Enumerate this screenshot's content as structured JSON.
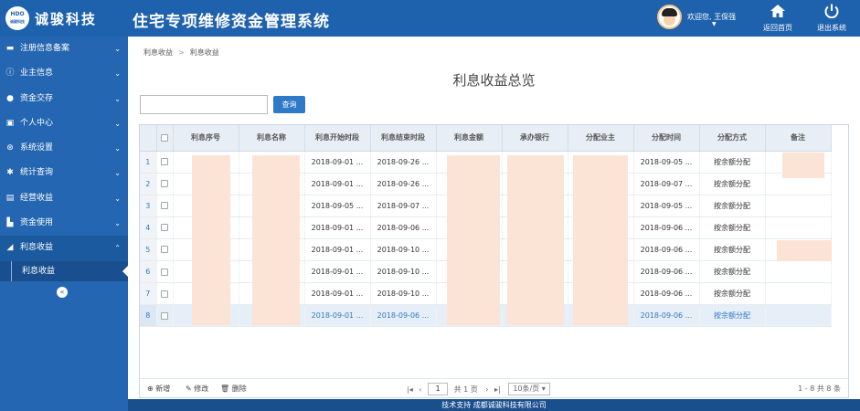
{
  "header": {
    "logo_text": "HDO",
    "logo_sub": "诚骏科技",
    "company": "诚骏科技",
    "system_title": "住宅专项维修资金管理系统",
    "welcome": "欢迎您, 王保强",
    "home_label": "返回首页",
    "exit_label": "退出系统"
  },
  "sidebar": {
    "items": [
      {
        "label": "注册信息备案",
        "icon": "id-card-icon"
      },
      {
        "label": "业主信息",
        "icon": "info-icon"
      },
      {
        "label": "资金交存",
        "icon": "user-icon"
      },
      {
        "label": "个人中心",
        "icon": "person-card-icon"
      },
      {
        "label": "系统设置",
        "icon": "settings-icon"
      },
      {
        "label": "统计查询",
        "icon": "gear-icon"
      },
      {
        "label": "经营收益",
        "icon": "database-icon"
      },
      {
        "label": "资金使用",
        "icon": "bar-chart-icon"
      },
      {
        "label": "利息收益",
        "icon": "area-chart-icon"
      }
    ],
    "sub_items": [
      {
        "label": "利息收益"
      }
    ]
  },
  "breadcrumb": {
    "first": "利息收益",
    "second": "利息收益"
  },
  "page_title": "利息收益总览",
  "search": {
    "value": "",
    "button_label": "查询"
  },
  "table": {
    "columns": [
      "利息序号",
      "利息名称",
      "利息开始时段",
      "利息结束时段",
      "利息金额",
      "承办银行",
      "分配业主",
      "分配时间",
      "分配方式",
      "备注"
    ],
    "rows": [
      {
        "n": "1",
        "start": "2018-09-01 ...",
        "end": "2018-09-26 ...",
        "time": "2018-09-05 ...",
        "method": "按余额分配"
      },
      {
        "n": "2",
        "start": "2018-09-01 ...",
        "end": "2018-09-26 ...",
        "time": "2018-09-07 ...",
        "method": "按余额分配"
      },
      {
        "n": "3",
        "start": "2018-09-05 ...",
        "end": "2018-09-07 ...",
        "time": "2018-09-05 ...",
        "method": "按余额分配"
      },
      {
        "n": "4",
        "start": "2018-09-01 ...",
        "end": "2018-09-06 ...",
        "time": "2018-09-06 ...",
        "method": "按余额分配"
      },
      {
        "n": "5",
        "start": "2018-09-01 ...",
        "end": "2018-09-10 ...",
        "time": "2018-09-06 ...",
        "method": "按余额分配"
      },
      {
        "n": "6",
        "start": "2018-09-01 ...",
        "end": "2018-09-10 ...",
        "time": "2018-09-06 ...",
        "method": "按余额分配"
      },
      {
        "n": "7",
        "start": "2018-09-01 ...",
        "end": "2018-09-10 ...",
        "time": "2018-09-06 ...",
        "method": "按余额分配"
      },
      {
        "n": "8",
        "start": "2018-09-01 ...",
        "end": "2018-09-06 ...",
        "time": "2018-09-06 ...",
        "method": "按余额分配"
      }
    ]
  },
  "toolbar": {
    "add": "新增",
    "edit": "修改",
    "delete": "删除"
  },
  "pager": {
    "page": "1",
    "of_pages": "共 1 页",
    "page_size": "10条/页",
    "range": "1 - 8   共 8 条"
  },
  "footer": "技术支持 成都诚骏科技有限公司",
  "colors": {
    "header": "#1e61ad",
    "sidebar": "#2466b1",
    "accent": "#2f7ac6",
    "redaction": "#fbe3d6"
  }
}
